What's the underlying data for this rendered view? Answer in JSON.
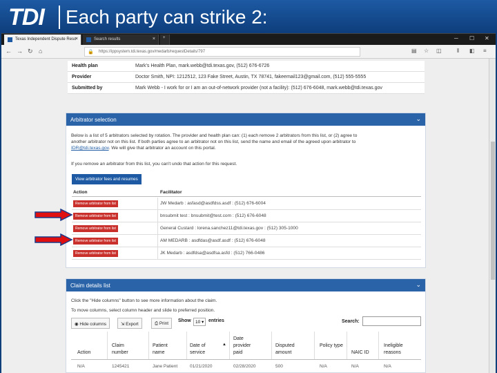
{
  "slide": {
    "logo": "TDI",
    "title": "Each party can strike 2:"
  },
  "browser": {
    "tabs": [
      {
        "label": "Texas Independent Dispute Reso"
      },
      {
        "label": "Search results"
      }
    ],
    "url": "https://ippsystem.tdi.texas.gov/medarb/requestDetails/797"
  },
  "details": [
    {
      "key": "Health plan",
      "value": "Mark's Health Plan, mark.webb@tdi.texas.gov, (512) 676-6726"
    },
    {
      "key": "Provider",
      "value": "Doctor Smith, NPI: 1212512, 123 Fake Street, Austin, TX 78741, fakeemail123@gmail.com, (512) 555-5555"
    },
    {
      "key": "Submitted by",
      "value": "Mark Webb - I work for or I am an out-of-network provider (not a facility): (512) 676-6048, mark.webb@tdi.texas.gov"
    }
  ],
  "arbitrator_panel": {
    "title": "Arbitrator selection",
    "intro_1": "Below is a list of 5 arbitrators selected by rotation. The provider and health plan can: (1) each remove 2 arbitrators from this list, or (2) agree to",
    "intro_2": "another arbitrator not on this list. If both parties agree to an arbitrator not on this list, send the name and email of the agreed upon arbitrator to",
    "intro_link": "IDR@tdi.texas.gov",
    "intro_3": ". We will give that arbitrator an account on this portal.",
    "warning": "If you remove an arbitrator from this list, you can't undo that action for this request.",
    "fees_button": "View arbitrator fees and resumes",
    "col_action": "Action",
    "col_facilitator": "Facilitator",
    "remove_label": "Remove arbitrator from list",
    "arbitrators": [
      "JW Medarb : asfasd@asdfdss.asdf : (512) 676-6004",
      "bnsubmit test : bnsubmit@test.com : (512) 676-6048",
      "General Custard : lorena.sanchez11@tdi.texas.gov : (512) 305-1000",
      "AM MEDARB : asdfdas@asdf.asdf : (512) 676-6048",
      "JK Medarb : asdfdsa@asdfsa.asfd : (512) 766-0486"
    ]
  },
  "claim_panel": {
    "title": "Claim details list",
    "hint_1": "Click the \"Hide columns\" button to see more information about the claim.",
    "hint_2": "To move columns, select column header and slide to preferred position.",
    "hide_columns": "Hide columns",
    "export": "Export",
    "print": "Print",
    "show": "Show",
    "show_value": "10",
    "entries": "entries",
    "search_label": "Search:",
    "headers": [
      "Action",
      "Claim number",
      "Patient name",
      "Date of service",
      "Date provider paid",
      "Disputed amount",
      "Policy type",
      "NAIC ID",
      "Ineligible reasons"
    ],
    "first_row": [
      "N/A",
      "1245421",
      "Jane Patient",
      "01/21/2020",
      "02/28/2020",
      "500",
      "N/A",
      "N/A",
      "N/A"
    ]
  },
  "colors": {
    "accent": "#1d5aa3",
    "remove": "#c9302c",
    "arrow": "#e01010"
  }
}
